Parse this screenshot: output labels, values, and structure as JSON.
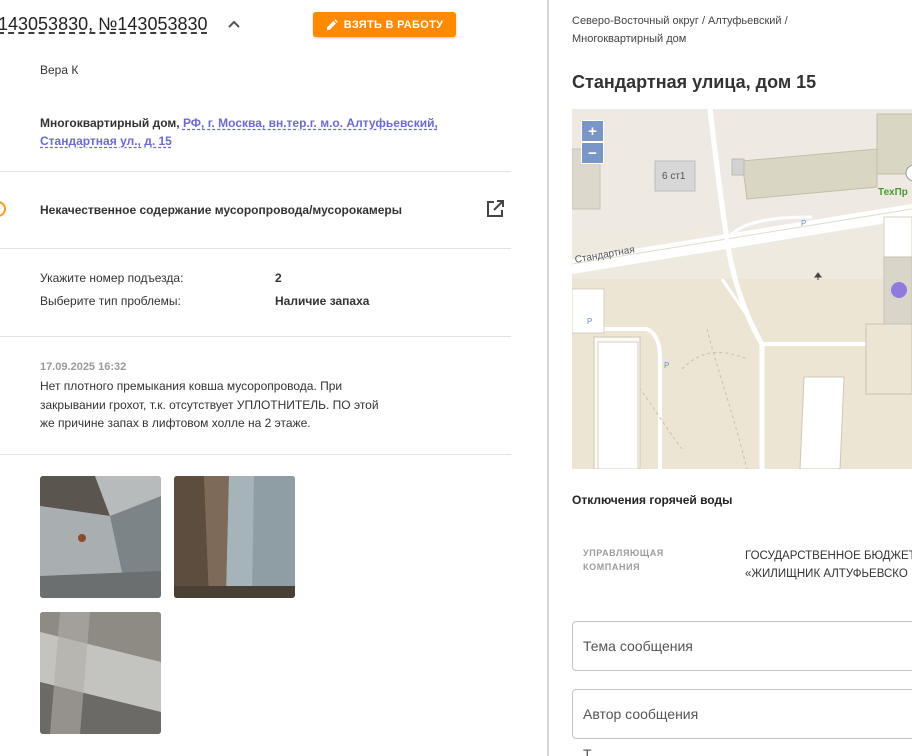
{
  "ticket": {
    "title": "143053830, №143053830",
    "take_button_label": "ВЗЯТЬ В РАБОТУ",
    "author": "Вера К",
    "address_type": "Многоквартирный дом,",
    "address_link": "РФ, г. Москва, вн.тер.г. м.о. Алтуфьевский, Стандартная ул., д. 15",
    "problem": "Некачественное содержание мусоропровода/мусорокамеры",
    "fields": [
      {
        "label": "Укажите номер подъезда:",
        "value": "2"
      },
      {
        "label": "Выберите тип проблемы:",
        "value": "Наличие запаха"
      }
    ],
    "comment": {
      "date": "17.09.2025 16:32",
      "text": "Нет плотного премыкания ковша мусоропровода. При закрывании грохот, т.к. отсутствует УПЛОТНИТЕЛЬ. ПО этой же причине запах в лифтовом холле на 2 этаже."
    },
    "photos_count": 3,
    "status_color": "#ff9a1a",
    "accent_color": "#ff8a00",
    "link_color": "#6a6ad0"
  },
  "details": {
    "breadcrumb_line1": "Северо-Восточный округ / Алтуфьевский /",
    "breadcrumb_line2": "Многоквартирный дом",
    "title": "Стандартная улица, дом 15",
    "map": {
      "zoom_in": "+",
      "zoom_out": "−",
      "building_label": "6 ст1",
      "street_label": "Стандартная",
      "poi_label": "ТехПр",
      "parking_label": "P"
    },
    "hot_water_title": "Отключения горячей воды",
    "management_label": "УПРАВЛЯЮЩАЯ КОМПАНИЯ",
    "management_line1": "ГОСУДАРСТВЕННОЕ БЮДЖЕТ",
    "management_line2": "«ЖИЛИЩНИК АЛТУФЬЕВСКО",
    "subject_placeholder": "Тема сообщения",
    "author_placeholder": "Автор сообщения",
    "third_field_stub": "Т"
  }
}
